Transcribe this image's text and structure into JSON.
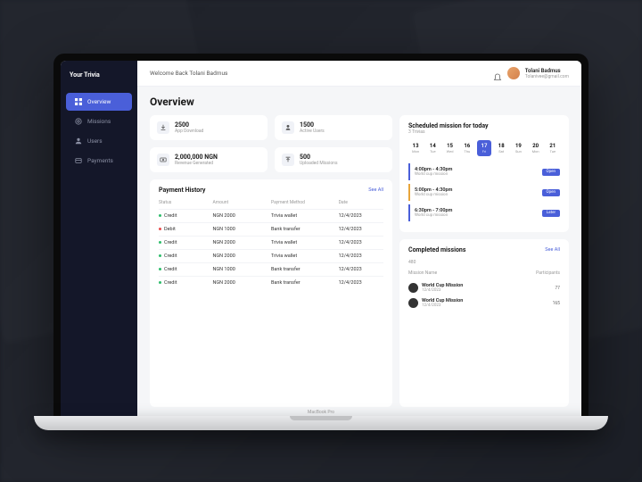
{
  "brand": "Your Trivia",
  "header": {
    "welcome": "Welcome Back Tolani Badmus",
    "user_name": "Tolani Badmus",
    "user_email": "Tolanivee@gmail.com"
  },
  "nav": {
    "overview": "Overview",
    "missions": "Missions",
    "users": "Users",
    "payments": "Payments"
  },
  "page_title": "Overview",
  "stats": {
    "downloads_val": "2500",
    "downloads_lbl": "App Download",
    "active_val": "1500",
    "active_lbl": "Active Users",
    "revenue_val": "2,000,000 NGN",
    "revenue_lbl": "Revenue Generated",
    "uploaded_val": "500",
    "uploaded_lbl": "Uploaded Missions"
  },
  "payment_history": {
    "title": "Payment History",
    "see_all": "See All",
    "cols": {
      "status": "Status",
      "amount": "Amount",
      "method": "Payment Method",
      "date": "Date"
    },
    "rows": [
      {
        "status": "Credit",
        "dot": "g",
        "amount": "NGN 2000",
        "method": "Trivia wallet",
        "date": "12/4/2023"
      },
      {
        "status": "Debit",
        "dot": "r",
        "amount": "NGN 1000",
        "method": "Bank transfer",
        "date": "12/4/2023"
      },
      {
        "status": "Credit",
        "dot": "g",
        "amount": "NGN 2000",
        "method": "Trivia wallet",
        "date": "12/4/2023"
      },
      {
        "status": "Credit",
        "dot": "g",
        "amount": "NGN 2000",
        "method": "Trivia wallet",
        "date": "12/4/2023"
      },
      {
        "status": "Credit",
        "dot": "g",
        "amount": "NGN 1000",
        "method": "Bank transfer",
        "date": "12/4/2023"
      },
      {
        "status": "Credit",
        "dot": "g",
        "amount": "NGN 2000",
        "method": "Bank transfer",
        "date": "12/4/2023"
      }
    ]
  },
  "scheduled": {
    "title": "Scheduled mission for today",
    "subtitle": "3 Trivias",
    "days": [
      {
        "num": "13",
        "dow": "Mon"
      },
      {
        "num": "14",
        "dow": "Tue"
      },
      {
        "num": "15",
        "dow": "Wed"
      },
      {
        "num": "16",
        "dow": "Thu"
      },
      {
        "num": "17",
        "dow": "Fri",
        "active": true
      },
      {
        "num": "18",
        "dow": "Sat"
      },
      {
        "num": "19",
        "dow": "Sun"
      },
      {
        "num": "20",
        "dow": "Mon"
      },
      {
        "num": "21",
        "dow": "Tue"
      }
    ],
    "missions": [
      {
        "time": "4:00pm - 4:30pm",
        "name": "World cup mission",
        "badge": "Open",
        "alt": false
      },
      {
        "time": "5:00pm - 4:30pm",
        "name": "World cup mission",
        "badge": "Open",
        "alt": true
      },
      {
        "time": "6:30pm - 7:00pm",
        "name": "World cup mission",
        "badge": "Later",
        "alt": false
      }
    ]
  },
  "completed": {
    "title": "Completed missions",
    "see_all": "See All",
    "count": "480",
    "col_name": "Mission Name",
    "col_part": "Participants",
    "rows": [
      {
        "name": "World Cup Mission",
        "date": "12/4/2023",
        "part": "77"
      },
      {
        "name": "World Cup Mission",
        "date": "12/4/2023",
        "part": "165"
      }
    ]
  },
  "device": "MacBook Pro"
}
